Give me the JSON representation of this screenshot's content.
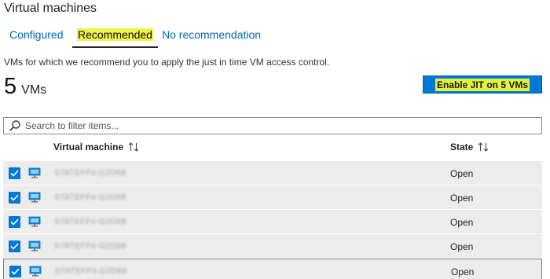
{
  "page": {
    "title": "Virtual machines"
  },
  "tabs": [
    {
      "label": "Configured",
      "selected": false
    },
    {
      "label": "Recommended",
      "selected": true
    },
    {
      "label": "No recommendation",
      "selected": false
    }
  ],
  "description": "VMs for which we recommend you to apply the just in time VM access control.",
  "vm_count": {
    "number": "5",
    "unit": "VMs"
  },
  "enable_button": {
    "label": "Enable JIT on 5 VMs"
  },
  "search": {
    "placeholder": "Search to filter items..."
  },
  "table": {
    "columns": [
      "Virtual machine",
      "State"
    ],
    "rows": [
      {
        "checked": true,
        "name": "STATEFP4-G2D6B",
        "state": "Open"
      },
      {
        "checked": true,
        "name": "STATEFP4-G2D6B",
        "state": "Open"
      },
      {
        "checked": true,
        "name": "STATEFP4-G2D6B",
        "state": "Open"
      },
      {
        "checked": true,
        "name": "STATEFP4-G2D6B",
        "state": "Open"
      },
      {
        "checked": true,
        "name": "STATEFP4-G2D6B",
        "state": "Open"
      }
    ]
  },
  "icons": {
    "search": "search-icon",
    "sort": "sort-arrows-icon",
    "checkbox": "checkmark-icon",
    "vm": "virtual-machine-icon"
  },
  "colors": {
    "accent": "#0078d4",
    "highlight": "#f2f24a",
    "row_background": "#ececec"
  }
}
